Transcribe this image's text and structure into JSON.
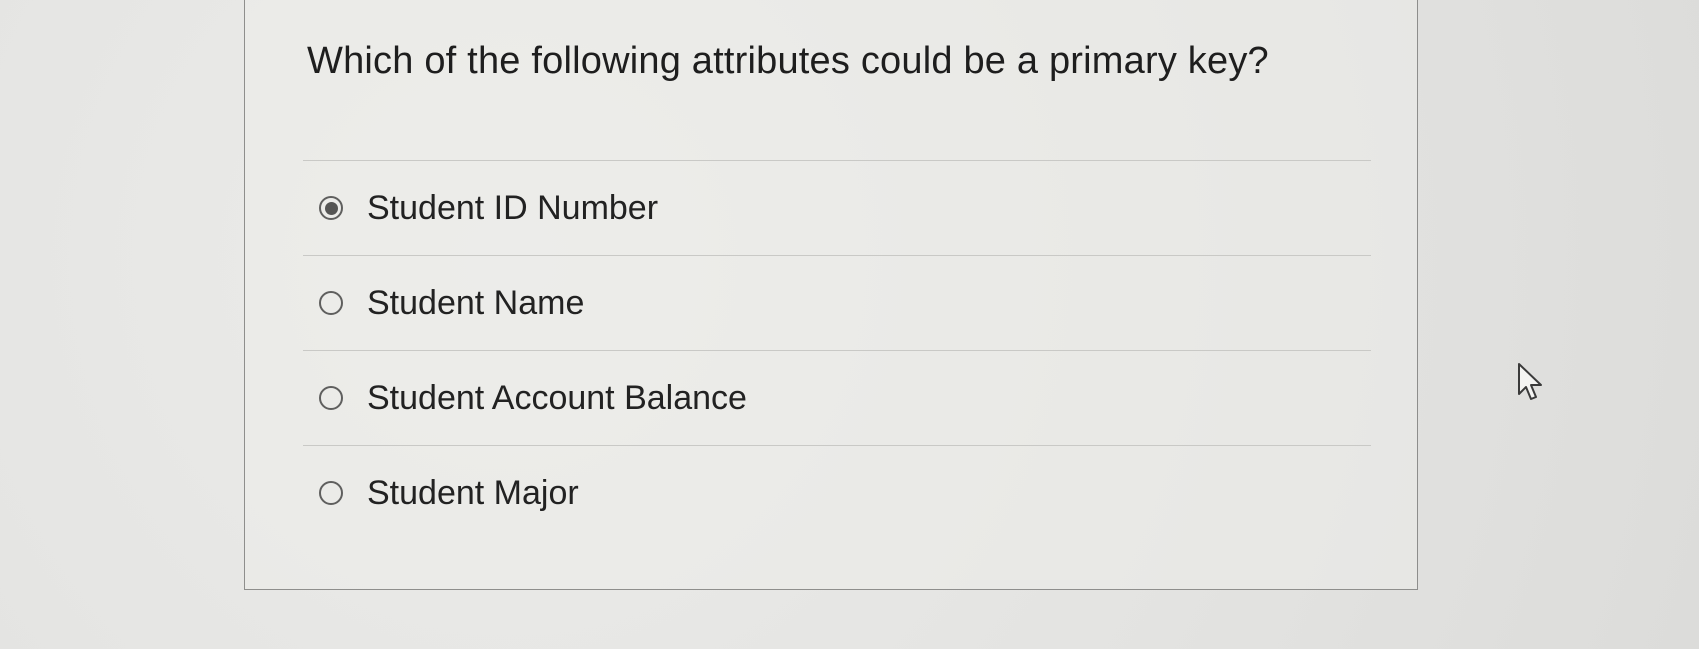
{
  "question": {
    "text": "Which of the following attributes could be a primary key?"
  },
  "answers": [
    {
      "label": "Student ID Number",
      "selected": true
    },
    {
      "label": "Student Name",
      "selected": false
    },
    {
      "label": "Student Account Balance",
      "selected": false
    },
    {
      "label": "Student Major",
      "selected": false
    }
  ],
  "cursor": {
    "icon": "arrow-pointer-icon"
  }
}
